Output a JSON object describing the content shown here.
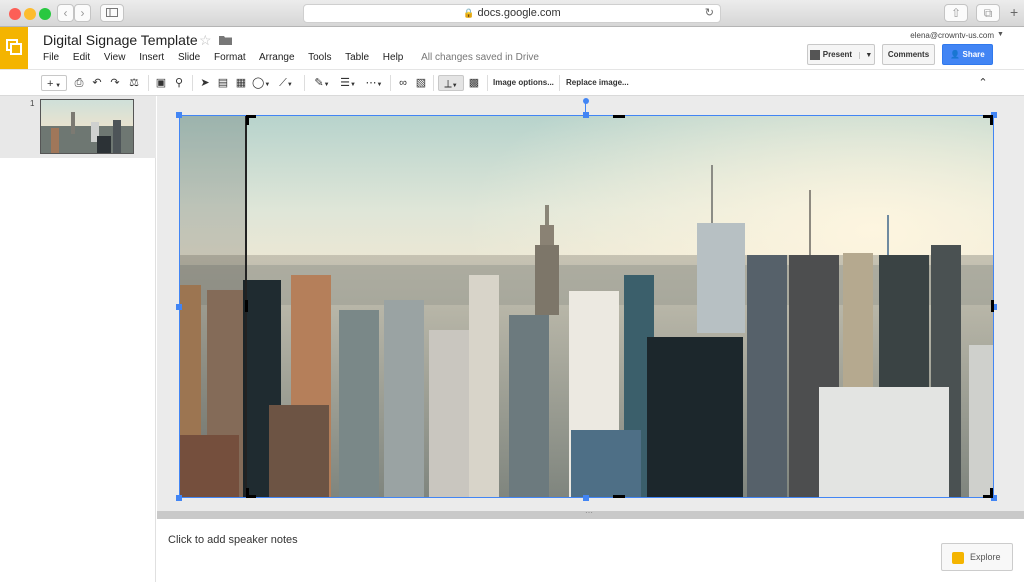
{
  "browser": {
    "url": "docs.google.com",
    "lock_icon": "lock-icon"
  },
  "doc": {
    "title": "Digital Signage Template",
    "save_status": "All changes saved in Drive",
    "user_email": "elena@crowntv-us.com"
  },
  "menu": [
    "File",
    "Edit",
    "View",
    "Insert",
    "Slide",
    "Format",
    "Arrange",
    "Tools",
    "Table",
    "Help"
  ],
  "header_buttons": {
    "present": "Present",
    "comments": "Comments",
    "share": "Share"
  },
  "toolbar": {
    "image_options": "Image options...",
    "replace_image": "Replace image..."
  },
  "filmstrip": {
    "slides": [
      {
        "number": "1"
      }
    ]
  },
  "notes": {
    "placeholder": "Click to add speaker notes"
  },
  "explore": {
    "label": "Explore"
  },
  "colors": {
    "accent_blue": "#4285f4",
    "slides_yellow": "#f4b400"
  }
}
